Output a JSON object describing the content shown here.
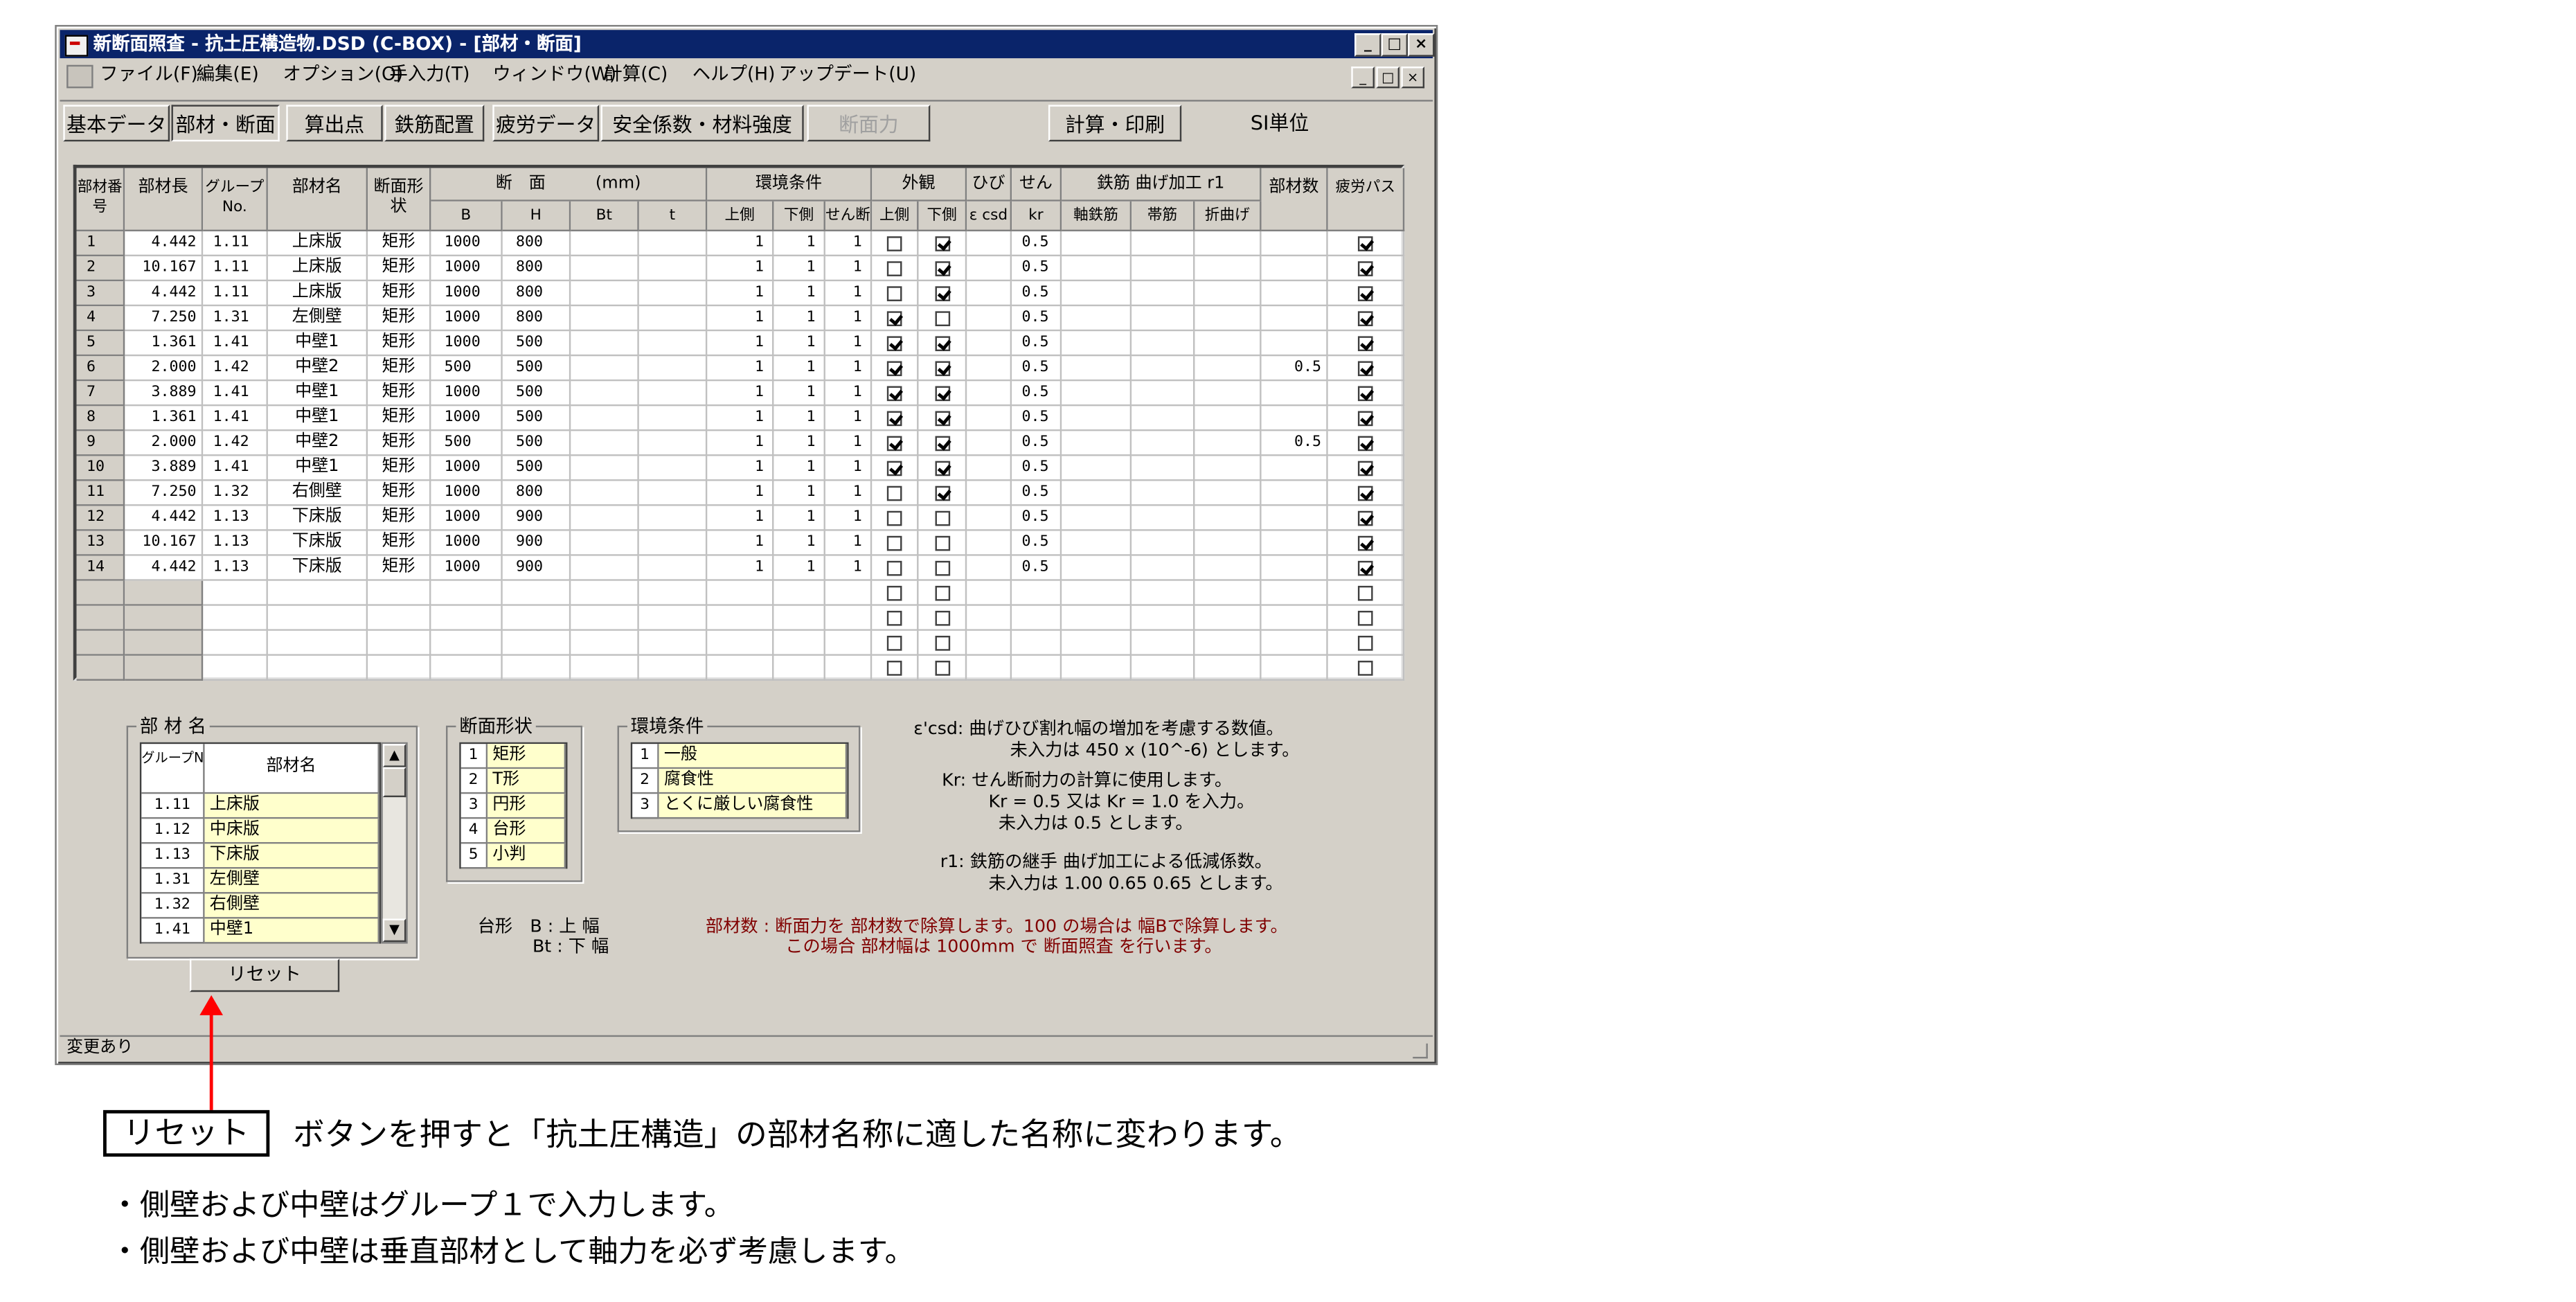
{
  "window": {
    "title": "新断面照査 - 抗土圧構造物.DSD (C-BOX) - [部材・断面]",
    "menu": [
      "ファイル(F)",
      "編集(E)",
      "オプション(O)",
      "手入力(T)",
      "ウィンドウ(W)",
      "計算(C)",
      "ヘルプ(H)",
      "アップデート(U)"
    ],
    "caption_buttons": [
      "_",
      "□",
      "×"
    ],
    "mdi_buttons": [
      "_",
      "□",
      "×"
    ],
    "toolbar": [
      "基本データ",
      "部材・断面",
      "算出点",
      "鉄筋配置",
      "疲労データ",
      "安全係数・材料強度",
      "断面力",
      "計算・印刷",
      "SI単位"
    ],
    "status": "変更あり"
  },
  "grid": {
    "headers_top": {
      "no": "部材番号",
      "len": "部材長",
      "grp": "グループNo.",
      "name": "部材名",
      "shape": "断面形状",
      "section": "断　面　　　(mm)",
      "env": "環境条件",
      "appear": "外観",
      "crack": "ひび割",
      "shear": "せん断",
      "bend": "鉄筋 曲げ加工 r1",
      "count": "部材数",
      "fatigue": "疲労パス"
    },
    "headers_sub": [
      "B",
      "H",
      "Bt",
      "t",
      "上側",
      "下側",
      "せん断",
      "上側",
      "下側",
      "ε csd",
      "kr",
      "軸鉄筋",
      "帯筋",
      "折曲げ"
    ],
    "rows": [
      {
        "no": "1",
        "len": "4.442",
        "grp": "1.11",
        "name": "上床版",
        "shape": "矩形",
        "B": "1000",
        "H": "800",
        "e1": "1",
        "e2": "1",
        "e3": "1",
        "a1": false,
        "a2": true,
        "kr": "0.5",
        "cnt": "",
        "f": true
      },
      {
        "no": "2",
        "len": "10.167",
        "grp": "1.11",
        "name": "上床版",
        "shape": "矩形",
        "B": "1000",
        "H": "800",
        "e1": "1",
        "e2": "1",
        "e3": "1",
        "a1": false,
        "a2": true,
        "kr": "0.5",
        "cnt": "",
        "f": true
      },
      {
        "no": "3",
        "len": "4.442",
        "grp": "1.11",
        "name": "上床版",
        "shape": "矩形",
        "B": "1000",
        "H": "800",
        "e1": "1",
        "e2": "1",
        "e3": "1",
        "a1": false,
        "a2": true,
        "kr": "0.5",
        "cnt": "",
        "f": true
      },
      {
        "no": "4",
        "len": "7.250",
        "grp": "1.31",
        "name": "左側壁",
        "shape": "矩形",
        "B": "1000",
        "H": "800",
        "e1": "1",
        "e2": "1",
        "e3": "1",
        "a1": true,
        "a2": false,
        "kr": "0.5",
        "cnt": "",
        "f": true
      },
      {
        "no": "5",
        "len": "1.361",
        "grp": "1.41",
        "name": "中壁1",
        "shape": "矩形",
        "B": "1000",
        "H": "500",
        "e1": "1",
        "e2": "1",
        "e3": "1",
        "a1": true,
        "a2": true,
        "kr": "0.5",
        "cnt": "",
        "f": true
      },
      {
        "no": "6",
        "len": "2.000",
        "grp": "1.42",
        "name": "中壁2",
        "shape": "矩形",
        "B": "500",
        "H": "500",
        "e1": "1",
        "e2": "1",
        "e3": "1",
        "a1": true,
        "a2": true,
        "kr": "0.5",
        "cnt": "0.5",
        "f": true
      },
      {
        "no": "7",
        "len": "3.889",
        "grp": "1.41",
        "name": "中壁1",
        "shape": "矩形",
        "B": "1000",
        "H": "500",
        "e1": "1",
        "e2": "1",
        "e3": "1",
        "a1": true,
        "a2": true,
        "kr": "0.5",
        "cnt": "",
        "f": true
      },
      {
        "no": "8",
        "len": "1.361",
        "grp": "1.41",
        "name": "中壁1",
        "shape": "矩形",
        "B": "1000",
        "H": "500",
        "e1": "1",
        "e2": "1",
        "e3": "1",
        "a1": true,
        "a2": true,
        "kr": "0.5",
        "cnt": "",
        "f": true
      },
      {
        "no": "9",
        "len": "2.000",
        "grp": "1.42",
        "name": "中壁2",
        "shape": "矩形",
        "B": "500",
        "H": "500",
        "e1": "1",
        "e2": "1",
        "e3": "1",
        "a1": true,
        "a2": true,
        "kr": "0.5",
        "cnt": "0.5",
        "f": true
      },
      {
        "no": "10",
        "len": "3.889",
        "grp": "1.41",
        "name": "中壁1",
        "shape": "矩形",
        "B": "1000",
        "H": "500",
        "e1": "1",
        "e2": "1",
        "e3": "1",
        "a1": true,
        "a2": true,
        "kr": "0.5",
        "cnt": "",
        "f": true
      },
      {
        "no": "11",
        "len": "7.250",
        "grp": "1.32",
        "name": "右側壁",
        "shape": "矩形",
        "B": "1000",
        "H": "800",
        "e1": "1",
        "e2": "1",
        "e3": "1",
        "a1": false,
        "a2": true,
        "kr": "0.5",
        "cnt": "",
        "f": true
      },
      {
        "no": "12",
        "len": "4.442",
        "grp": "1.13",
        "name": "下床版",
        "shape": "矩形",
        "B": "1000",
        "H": "900",
        "e1": "1",
        "e2": "1",
        "e3": "1",
        "a1": false,
        "a2": false,
        "kr": "0.5",
        "cnt": "",
        "f": true
      },
      {
        "no": "13",
        "len": "10.167",
        "grp": "1.13",
        "name": "下床版",
        "shape": "矩形",
        "B": "1000",
        "H": "900",
        "e1": "1",
        "e2": "1",
        "e3": "1",
        "a1": false,
        "a2": false,
        "kr": "0.5",
        "cnt": "",
        "f": true
      },
      {
        "no": "14",
        "len": "4.442",
        "grp": "1.13",
        "name": "下床版",
        "shape": "矩形",
        "B": "1000",
        "H": "900",
        "e1": "1",
        "e2": "1",
        "e3": "1",
        "a1": false,
        "a2": false,
        "kr": "0.5",
        "cnt": "",
        "f": true
      }
    ]
  },
  "member_names": {
    "title": "部 材 名",
    "col1": "グループNo.",
    "col2": "部材名",
    "items": [
      {
        "no": "1.11",
        "name": "上床版"
      },
      {
        "no": "1.12",
        "name": "中床版"
      },
      {
        "no": "1.13",
        "name": "下床版"
      },
      {
        "no": "1.31",
        "name": "左側壁"
      },
      {
        "no": "1.32",
        "name": "右側壁"
      },
      {
        "no": "1.41",
        "name": "中壁1"
      }
    ],
    "reset_label": "リセット"
  },
  "section_shapes": {
    "title": "断面形状",
    "items": [
      {
        "no": "1",
        "name": "矩形"
      },
      {
        "no": "2",
        "name": "T形"
      },
      {
        "no": "3",
        "name": "円形"
      },
      {
        "no": "4",
        "name": "台形"
      },
      {
        "no": "5",
        "name": "小判"
      }
    ]
  },
  "env_conditions": {
    "title": "環境条件",
    "items": [
      {
        "no": "1",
        "name": "一般"
      },
      {
        "no": "2",
        "name": "腐食性"
      },
      {
        "no": "3",
        "name": "とくに厳しい腐食性"
      }
    ]
  },
  "notes": {
    "csd1": "ε'csd: 曲げひび割れ幅の増加を考慮する数値。",
    "csd2": "未入力は 450 x (10^-6) とします。",
    "kr1": "Kr: せん断耐力の計算に使用します。",
    "kr2": "Kr = 0.5 又は Kr = 1.0 を入力。",
    "kr3": "未入力は 0.5 とします。",
    "r1a": "r1: 鉄筋の継手 曲げ加工による低減係数。",
    "r1b": "未入力は 1.00 0.65 0.65 とします。",
    "trap1": "台形　B : 上 幅",
    "trap2": "Bt : 下 幅",
    "cnt1": "部材数 : 断面力を 部材数で除算します。100 の場合は 幅Bで除算します。",
    "cnt2": "この場合 部材幅は 1000mm で 断面照査 を行います。"
  },
  "caption": {
    "button_label": "リセット",
    "text": "ボタンを押すと「抗土圧構造」の部材名称に適した名称に変わります。",
    "bullet1": "・側壁および中壁はグループ１で入力します。",
    "bullet2": "・側壁および中壁は垂直部材として軸力を必ず考慮します。"
  },
  "colors": {
    "title_bar": "#0a246a",
    "face": "#d4d0c8",
    "table_yellow": "#ffffcc",
    "arrow": "#ff0000",
    "note_red": "#800000"
  }
}
